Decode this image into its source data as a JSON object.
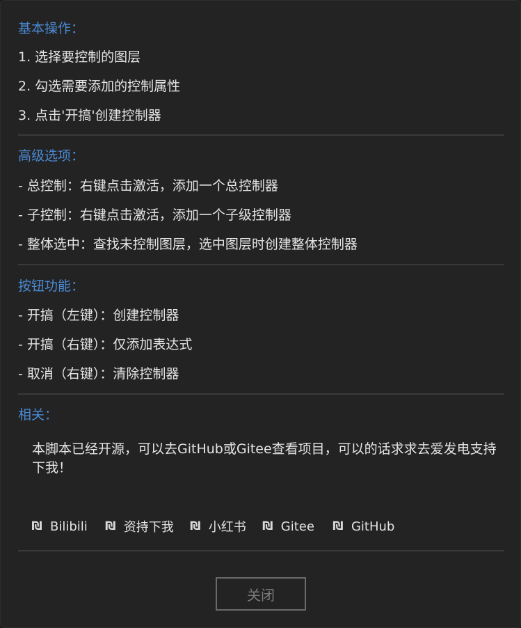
{
  "basic": {
    "heading": "基本操作：",
    "steps": [
      "1. 选择要控制的图层",
      "2. 勾选需要添加的控制属性",
      "3. 点击'开搞'创建控制器"
    ]
  },
  "advanced": {
    "heading": "高级选项：",
    "items": [
      "- 总控制：右键点击激活，添加一个总控制器",
      "- 子控制：右键点击激活，添加一个子级控制器",
      "- 整体选中：查找未控制图层，选中图层时创建整体控制器"
    ]
  },
  "buttons": {
    "heading": "按钮功能：",
    "items": [
      "- 开搞（左键）：创建控制器",
      "- 开搞（右键）：仅添加表达式",
      "- 取消（右键）：清除控制器"
    ]
  },
  "related": {
    "heading": "相关：",
    "description": "本脚本已经开源，可以去GitHub或Gitee查看项目，可以的话求求去爱发电支持下我！",
    "links": [
      {
        "icon": "link-icon",
        "glyph": "₪",
        "label": "Bilibili"
      },
      {
        "icon": "link-icon",
        "glyph": "₪",
        "label": "资持下我"
      },
      {
        "icon": "link-icon",
        "glyph": "₪",
        "label": "小红书"
      },
      {
        "icon": "link-icon",
        "glyph": "₪",
        "label": "Gitee"
      },
      {
        "icon": "link-icon",
        "glyph": "₪",
        "label": "GitHub"
      }
    ]
  },
  "footer": {
    "close_label": "关闭"
  }
}
